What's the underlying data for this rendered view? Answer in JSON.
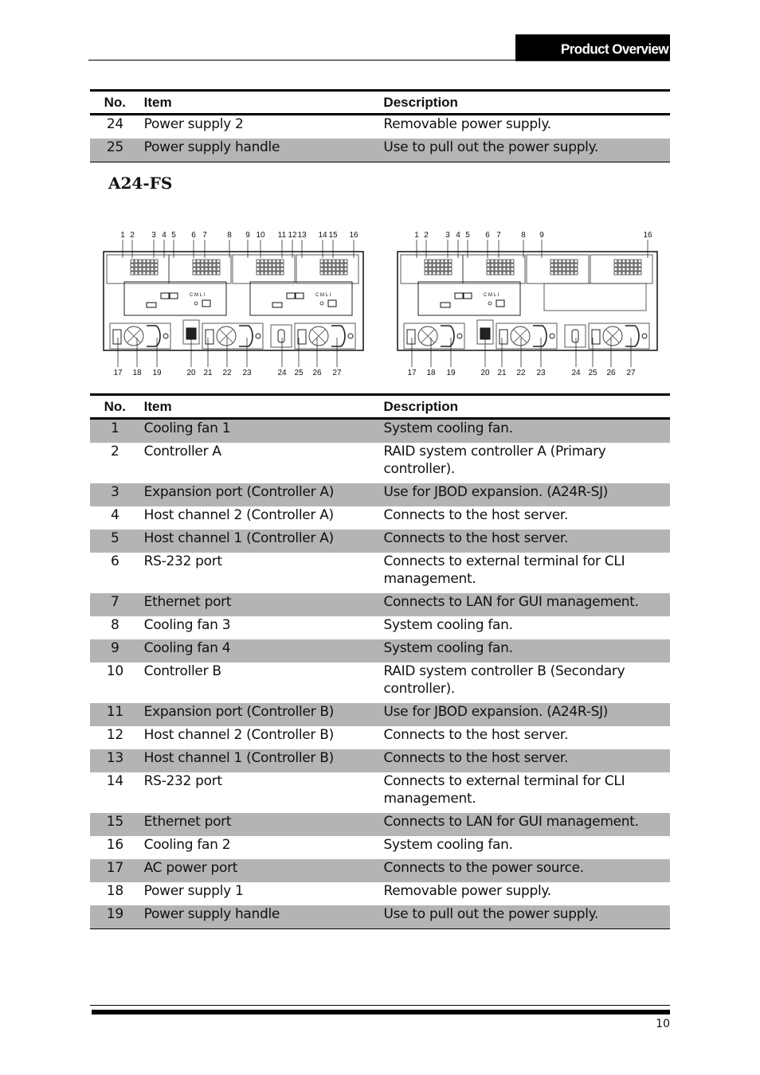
{
  "header": {
    "section_title": "Product Overview"
  },
  "top_table": {
    "columns": [
      "No.",
      "Item",
      "Description"
    ],
    "rows": [
      {
        "no": "24",
        "item": "Power supply 2",
        "desc": "Removable power supply."
      },
      {
        "no": "25",
        "item": "Power supply handle",
        "desc": "Use to pull out the power supply."
      }
    ]
  },
  "model_heading": "A24-FS",
  "figures": {
    "left_top_callouts": [
      "1",
      "2",
      "3",
      "4",
      "5",
      "6",
      "7",
      "8",
      "9",
      "10",
      "11",
      "12",
      "13",
      "14",
      "15",
      "16"
    ],
    "left_bottom_callouts": [
      "17",
      "18",
      "19",
      "20",
      "21",
      "22",
      "23",
      "24",
      "25",
      "26",
      "27"
    ],
    "right_top_callouts": [
      "1",
      "2",
      "3",
      "4",
      "5",
      "6",
      "7",
      "8",
      "9",
      "16"
    ],
    "right_bottom_callouts": [
      "17",
      "18",
      "19",
      "20",
      "21",
      "22",
      "23",
      "24",
      "25",
      "26",
      "27"
    ],
    "port_labels": [
      "C M",
      "L I"
    ]
  },
  "main_table": {
    "columns": [
      "No.",
      "Item",
      "Description"
    ],
    "rows": [
      {
        "no": "1",
        "item": "Cooling fan 1",
        "desc": "System cooling fan."
      },
      {
        "no": "2",
        "item": "Controller A",
        "desc": "RAID system controller A (Primary controller)."
      },
      {
        "no": "3",
        "item": "Expansion port (Controller A)",
        "desc": "Use for JBOD expansion. (A24R-SJ)"
      },
      {
        "no": "4",
        "item": "Host channel 2 (Controller A)",
        "desc": "Connects to the host server."
      },
      {
        "no": "5",
        "item": "Host channel 1 (Controller A)",
        "desc": "Connects to the host server."
      },
      {
        "no": "6",
        "item": "RS-232 port",
        "desc": "Connects to external terminal for CLI management."
      },
      {
        "no": "7",
        "item": "Ethernet port",
        "desc": "Connects to LAN for GUI management."
      },
      {
        "no": "8",
        "item": "Cooling fan 3",
        "desc": "System cooling fan."
      },
      {
        "no": "9",
        "item": "Cooling fan 4",
        "desc": "System cooling fan."
      },
      {
        "no": "10",
        "item": "Controller B",
        "desc": "RAID system controller B (Secondary controller)."
      },
      {
        "no": "11",
        "item": "Expansion port (Controller B)",
        "desc": "Use for JBOD expansion. (A24R-SJ)"
      },
      {
        "no": "12",
        "item": "Host channel 2 (Controller B)",
        "desc": "Connects to the host server."
      },
      {
        "no": "13",
        "item": "Host channel 1 (Controller B)",
        "desc": "Connects to the host server."
      },
      {
        "no": "14",
        "item": "RS-232 port",
        "desc": "Connects to external terminal for CLI management."
      },
      {
        "no": "15",
        "item": "Ethernet port",
        "desc": "Connects to LAN for GUI management."
      },
      {
        "no": "16",
        "item": "Cooling fan 2",
        "desc": "System cooling fan."
      },
      {
        "no": "17",
        "item": "AC power port",
        "desc": "Connects to the power source."
      },
      {
        "no": "18",
        "item": "Power supply 1",
        "desc": "Removable power supply."
      },
      {
        "no": "19",
        "item": "Power supply handle",
        "desc": "Use to pull out the power supply."
      }
    ]
  },
  "colors": {
    "row_shade": "#b4b4b4",
    "rule": "#000000"
  },
  "footer": {
    "page_number": "10"
  }
}
